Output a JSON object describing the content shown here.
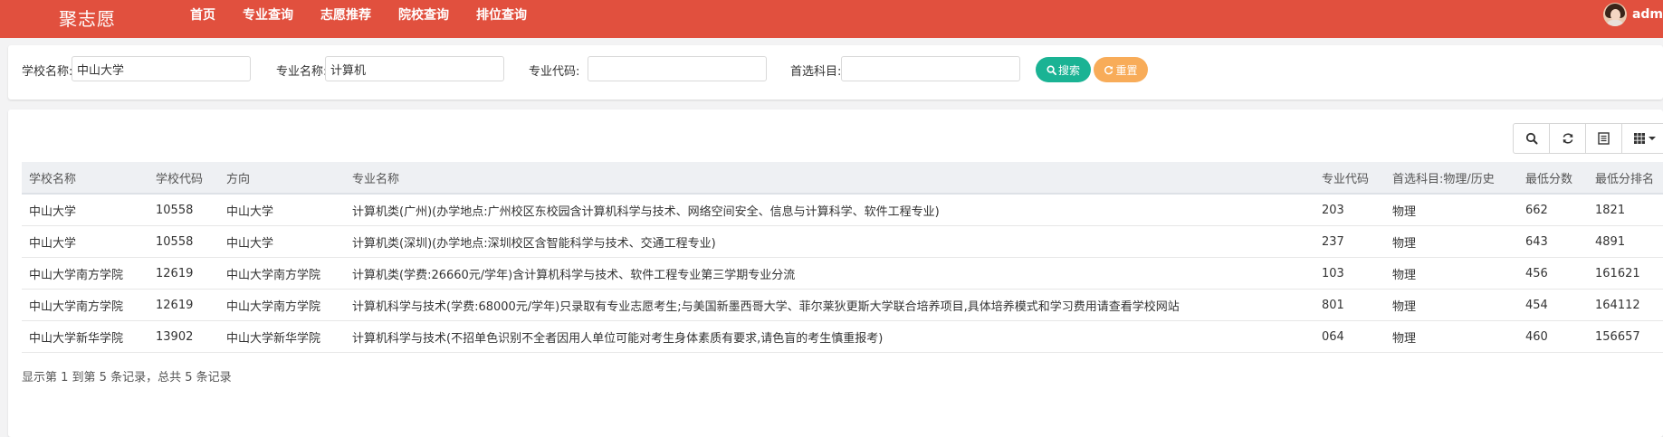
{
  "brand": "聚志愿",
  "nav": [
    "首页",
    "专业查询",
    "志愿推荐",
    "院校查询",
    "排位查询"
  ],
  "user": {
    "name": "adm"
  },
  "search": {
    "school_label": "学校名称:",
    "school_value": "中山大学",
    "major_label": "专业名称:",
    "major_value": "计算机",
    "code_label": "专业代码:",
    "code_value": "",
    "subject_label": "首选科目:",
    "subject_value": "",
    "search_button": "搜索",
    "reset_button": "重置"
  },
  "table": {
    "columns": [
      "学校名称",
      "学校代码",
      "方向",
      "专业名称",
      "专业代码",
      "首选科目:物理/历史",
      "最低分数",
      "最低分排名"
    ],
    "rows": [
      [
        "中山大学",
        "10558",
        "中山大学",
        "计算机类(广州)(办学地点:广州校区东校园含计算机科学与技术、网络空间安全、信息与计算科学、软件工程专业)",
        "203",
        "物理",
        "662",
        "1821"
      ],
      [
        "中山大学",
        "10558",
        "中山大学",
        "计算机类(深圳)(办学地点:深圳校区含智能科学与技术、交通工程专业)",
        "237",
        "物理",
        "643",
        "4891"
      ],
      [
        "中山大学南方学院",
        "12619",
        "中山大学南方学院",
        "计算机类(学费:26660元/学年)含计算机科学与技术、软件工程专业第三学期专业分流",
        "103",
        "物理",
        "456",
        "161621"
      ],
      [
        "中山大学南方学院",
        "12619",
        "中山大学南方学院",
        "计算机科学与技术(学费:68000元/学年)只录取有专业志愿考生;与美国新墨西哥大学、菲尔莱狄更斯大学联合培养项目,具体培养模式和学习费用请查看学校网站",
        "801",
        "物理",
        "454",
        "164112"
      ],
      [
        "中山大学新华学院",
        "13902",
        "中山大学新华学院",
        "计算机科学与技术(不招单色识别不全者因用人单位可能对考生身体素质有要求,请色盲的考生慎重报考)",
        "064",
        "物理",
        "460",
        "156657"
      ]
    ]
  },
  "pagination": "显示第 1 到第 5 条记录，总共 5 条记录",
  "colors": {
    "topbar": "#e1503e",
    "search_button": "#1ab394",
    "reset_button": "#f8ac59"
  }
}
